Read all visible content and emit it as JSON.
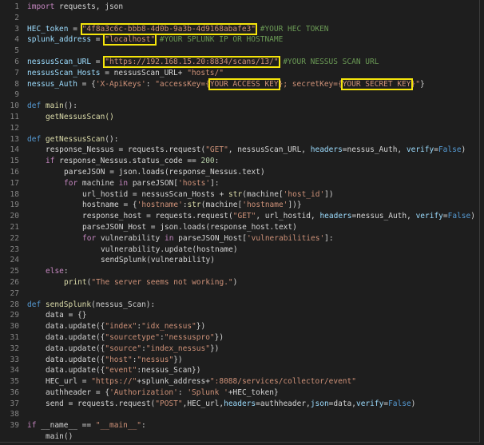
{
  "editor": {
    "line_numbers": [
      "1",
      "2",
      "3",
      "4",
      "5",
      "6",
      "7",
      "8",
      "9",
      "10",
      "11",
      "12",
      "13",
      "14",
      "15",
      "16",
      "17",
      "18",
      "19",
      "20",
      "21",
      "22",
      "23",
      "24",
      "25",
      "26",
      "27",
      "28",
      "29",
      "30",
      "31",
      "32",
      "33",
      "34",
      "35",
      "36",
      "37",
      "38",
      "39"
    ],
    "code": {
      "l1_import": "import",
      "l1_rest": " requests, json",
      "l3_var": "HEC_token",
      "l3_eq": " = ",
      "l3_val": "\"4f8a3c6c-bbb8-4d0b-9a3b-4d9168abafe3\"",
      "l3_cm": " #YOUR HEC TOKEN",
      "l4_var": "splunk_address",
      "l4_eq": " = ",
      "l4_val": "\"localhost\"",
      "l4_cm": " #YOUR SPLUNK IP OR HOSTNAME",
      "l6_var": "nessusScan_URL",
      "l6_eq": " = ",
      "l6_val": "\"https://192.168.15.20:8834/scans/13/\"",
      "l6_cm": " #YOUR NESSUS SCAN URL",
      "l7_var": "nessusScan_Hosts",
      "l7_rest": " = nessusScan_URL+ ",
      "l7_val": "\"hosts/\"",
      "l8_var": "nessus_Auth",
      "l8_eq": " = {",
      "l8_key": "'X-ApiKeys'",
      "l8_colon": ": ",
      "l8_s1": "\"accessKey={",
      "l8_h1": "YOUR ACCESS KEY",
      "l8_s2": "}; secretKey={",
      "l8_h2": "YOUR SECRET KEY",
      "l8_s3": "}\"",
      "l8_end": "}",
      "l10_def": "def",
      "l10_fn": " main",
      "l10_rest": "():",
      "l11": "getNessusScan()",
      "l13_def": "def",
      "l13_fn": " getNessusScan",
      "l13_rest": "():",
      "l14_a": "response_Nessus = requests.request(",
      "l14_s1": "\"GET\"",
      "l14_b": ", nessusScan_URL, ",
      "l14_p1": "headers",
      "l14_c": "=nessus_Auth, ",
      "l14_p2": "verify",
      "l14_d": "=",
      "l14_f": "False",
      "l14_e": ")",
      "l15_if": "if",
      "l15_a": " response_Nessus.status_code == ",
      "l15_n": "200",
      "l15_b": ":",
      "l16": "parseJSON = json.loads(response_Nessus.text)",
      "l17_for": "for",
      "l17_a": " machine ",
      "l17_in": "in",
      "l17_b": " parseJSON[",
      "l17_s": "'hosts'",
      "l17_c": "]:",
      "l18_a": "url_hostid = nessusScan_Hosts + ",
      "l18_fn": "str",
      "l18_b": "(machine[",
      "l18_s": "'host_id'",
      "l18_c": "])",
      "l19_a": "hostname = {",
      "l19_s1": "'hostname'",
      "l19_b": ":",
      "l19_fn": "str",
      "l19_c": "(machine[",
      "l19_s2": "'hostname'",
      "l19_d": "])}",
      "l20_a": "response_host = requests.request(",
      "l20_s": "\"GET\"",
      "l20_b": ", url_hostid, ",
      "l20_p1": "headers",
      "l20_c": "=nessus_Auth, ",
      "l20_p2": "verify",
      "l20_d": "=",
      "l20_f": "False",
      "l20_e": ")",
      "l21": "parseJSON_Host = json.loads(response_host.text)",
      "l22_for": "for",
      "l22_a": " vulnerability ",
      "l22_in": "in",
      "l22_b": " parseJSON_Host[",
      "l22_s": "'vulnerabilities'",
      "l22_c": "]:",
      "l23": "vulnerability.update(hostname)",
      "l24": "sendSplunk(vulnerability)",
      "l25_else": "else",
      "l25_b": ":",
      "l26_fn": "print",
      "l26_a": "(",
      "l26_s": "\"The server seems not working.\"",
      "l26_b": ")",
      "l28_def": "def",
      "l28_fn": " sendSplunk",
      "l28_rest": "(nessus_Scan):",
      "l29": "data = {}",
      "l30_a": "data.update({",
      "l30_k": "\"index\"",
      "l30_b": ":",
      "l30_v": "\"idx_nessus\"",
      "l30_c": "})",
      "l31_a": "data.update({",
      "l31_k": "\"sourcetype\"",
      "l31_b": ":",
      "l31_v": "\"nessuspro\"",
      "l31_c": "})",
      "l32_a": "data.update({",
      "l32_k": "\"source\"",
      "l32_b": ":",
      "l32_v": "\"index_nessus\"",
      "l32_c": "})",
      "l33_a": "data.update({",
      "l33_k": "\"host\"",
      "l33_b": ":",
      "l33_v": "\"nessus\"",
      "l33_c": "})",
      "l34_a": "data.update({",
      "l34_k": "\"event\"",
      "l34_b": ":nessus_Scan})",
      "l35_a": "HEC_url = ",
      "l35_s1": "\"https://\"",
      "l35_b": "+splunk_address+",
      "l35_s2": "\":8088/services/collector/event\"",
      "l36_a": "authheader = {",
      "l36_k": "'Authorization'",
      "l36_b": ": ",
      "l36_v": "'Splunk '",
      "l36_c": "+HEC_token}",
      "l37_a": "send = requests.request(",
      "l37_s": "\"POST\"",
      "l37_b": ",HEC_url,",
      "l37_p1": "headers",
      "l37_c": "=authheader,",
      "l37_p2": "json",
      "l37_d": "=data,",
      "l37_p3": "verify",
      "l37_e": "=",
      "l37_f": "False",
      "l37_g": ")",
      "l38_if": "if",
      "l38_a": " __name__ == ",
      "l38_s": "\"__main__\"",
      "l38_b": ":",
      "l39": "main()"
    },
    "colors": {
      "background": "#1e1e1e",
      "highlight_box": "#f5e50b",
      "keyword": "#569cd6",
      "control": "#c586c0",
      "function": "#dcdcaa",
      "string": "#ce9178",
      "comment": "#6a9955"
    }
  }
}
